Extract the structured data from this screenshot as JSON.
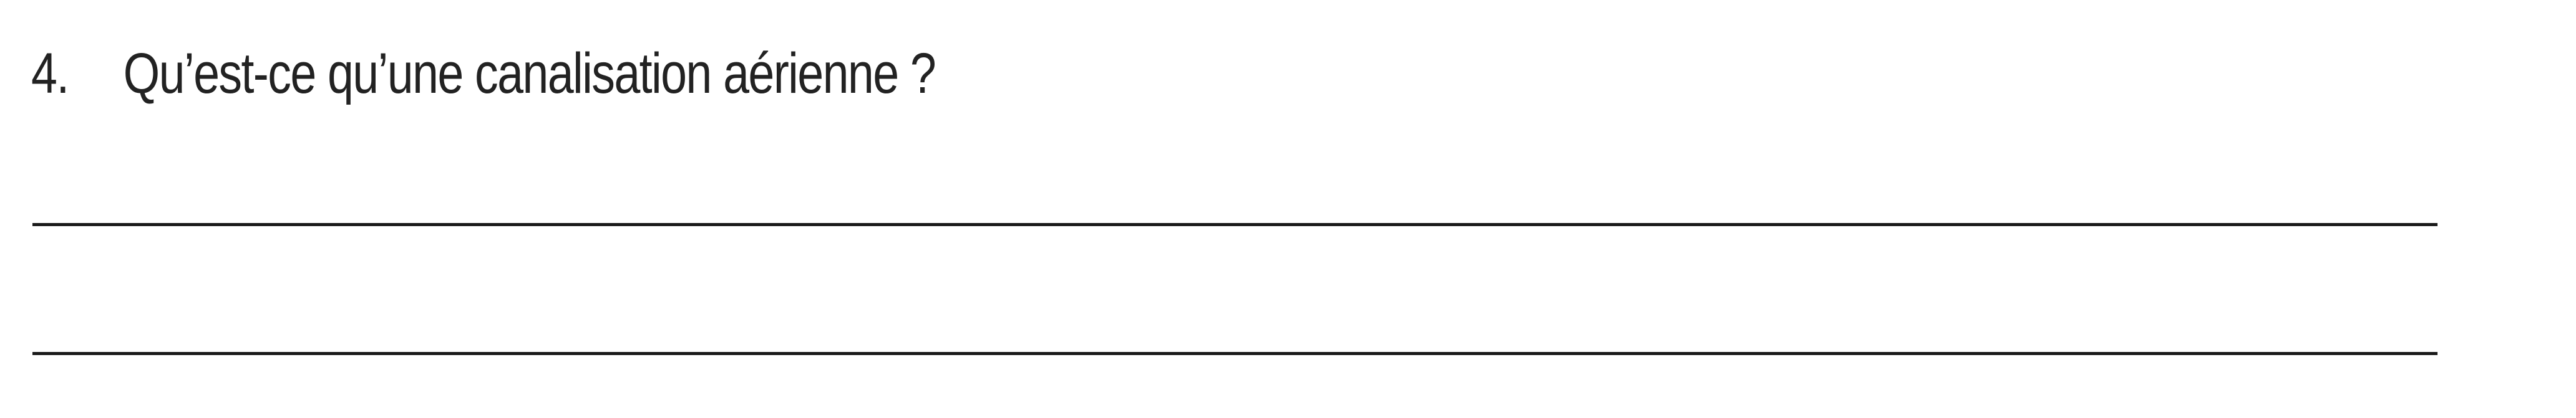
{
  "question": {
    "number": "4.",
    "text": "Qu’est-ce qu’une canalisation aérienne ?"
  },
  "answer_lines": [
    "",
    ""
  ]
}
